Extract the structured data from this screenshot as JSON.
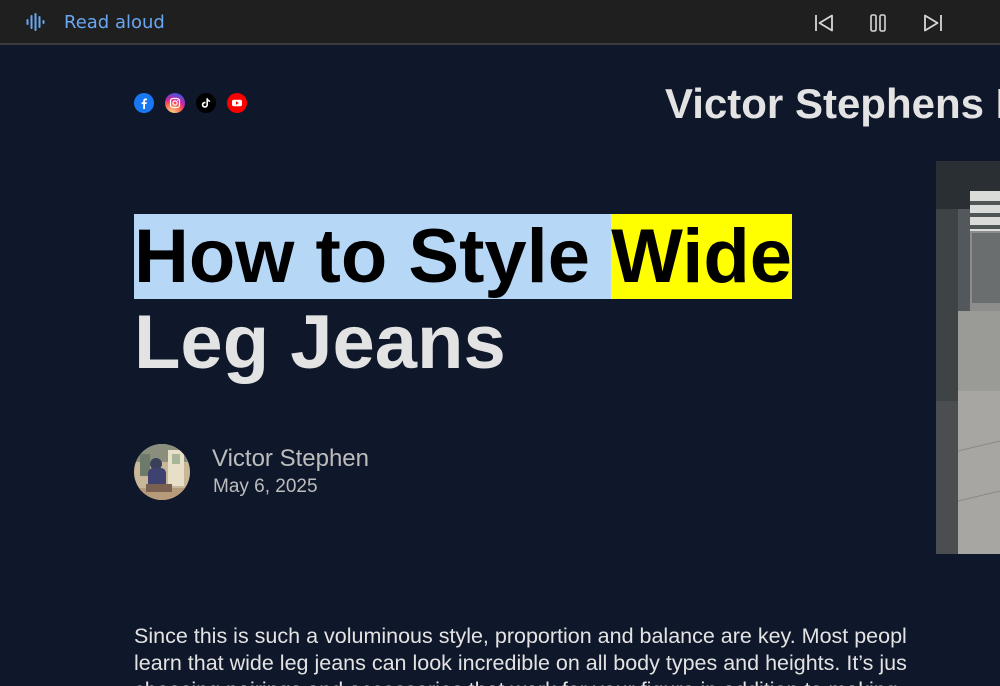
{
  "toolbar": {
    "read_aloud_label": "Read aloud",
    "icons": [
      "read-aloud-icon",
      "previous-icon",
      "pause-icon",
      "next-icon"
    ],
    "accent_color": "#6aa7f3"
  },
  "header": {
    "site_title": "Victor Stephens B",
    "social_icons": [
      "facebook-icon",
      "instagram-icon",
      "tiktok-icon",
      "youtube-icon"
    ]
  },
  "article": {
    "headline_read": "How to Style ",
    "headline_current_word": "Wide",
    "headline_rest": "Leg Jeans",
    "author_name": "Victor Stephen",
    "date": "May 6, 2025",
    "body_lines": [
      "Since this is such a voluminous style, proportion and balance are key. Most peopl",
      "learn that wide leg jeans can look incredible on all body types and heights. It’s jus",
      "choosing pairings and accessories that work for your figure in addition to making"
    ]
  },
  "colors": {
    "page_background": "#0f172a",
    "read_highlight": "#b6d8f6",
    "current_word_highlight": "#ffff00",
    "text": "#e3e3e3"
  }
}
